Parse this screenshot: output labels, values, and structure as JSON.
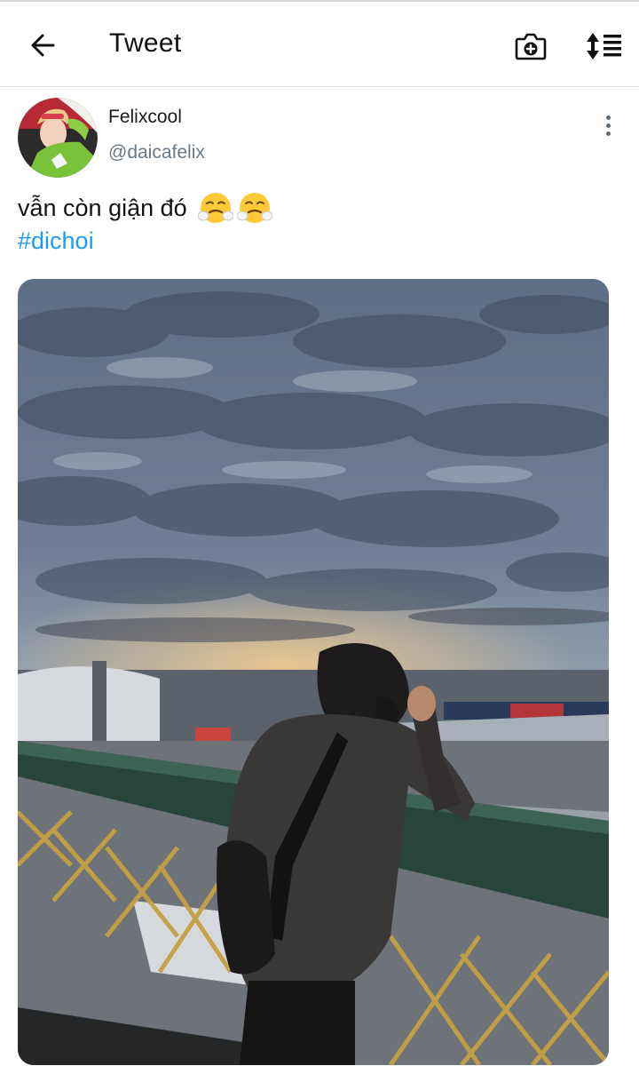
{
  "header": {
    "title": "Tweet",
    "back_icon": "arrow-left-icon",
    "camera_icon": "camera-add-icon",
    "sort_icon": "sort-list-icon"
  },
  "tweet": {
    "author": {
      "display_name": "Felixcool",
      "handle": "@daicafelix",
      "avatar_icon": "avatar-photo"
    },
    "text": "vẫn còn giận đó",
    "emojis": [
      "face-with-steam-from-nose",
      "face-with-steam-from-nose"
    ],
    "hashtag": "#dichoi",
    "media_description_icon": "photo-sunset-railing",
    "more_icon": "more-vertical-icon"
  },
  "colors": {
    "link": "#1d9bf0",
    "handle": "#6a7985",
    "text": "#141414"
  }
}
